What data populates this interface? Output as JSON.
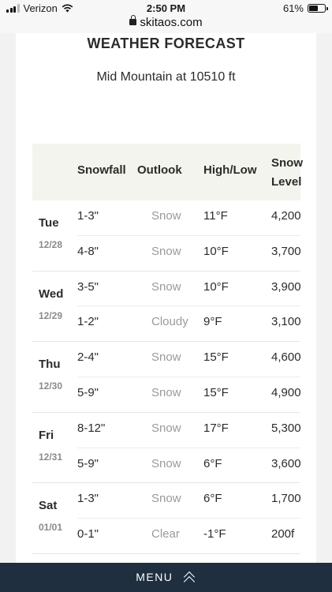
{
  "status_bar": {
    "carrier": "Verizon",
    "time": "2:50 PM",
    "battery_percent": "61%",
    "battery_level": 0.61,
    "icons": [
      "signal-bars-icon",
      "wifi-icon",
      "battery-icon"
    ]
  },
  "url_bar": {
    "domain": "skitaos.com",
    "icon": "lock-icon"
  },
  "forecast": {
    "title": "WEATHER FORECAST",
    "subtitle": "Mid Mountain at 10510 ft",
    "columns": {
      "snowfall": "Snowfall",
      "outlook": "Outlook",
      "high_low": "High/Low",
      "snow_level_line1": "Snow",
      "snow_level_line2": "Level"
    },
    "days": [
      {
        "name": "Tue",
        "date": "12/28",
        "rows": [
          {
            "snowfall": "1-3\"",
            "outlook": "Snow",
            "high_low": "11°F",
            "snow_level": "4,200"
          },
          {
            "snowfall": "4-8\"",
            "outlook": "Snow",
            "high_low": "10°F",
            "snow_level": "3,700"
          }
        ]
      },
      {
        "name": "Wed",
        "date": "12/29",
        "rows": [
          {
            "snowfall": "3-5\"",
            "outlook": "Snow",
            "high_low": "10°F",
            "snow_level": "3,900"
          },
          {
            "snowfall": "1-2\"",
            "outlook": "Cloudy",
            "high_low": "9°F",
            "snow_level": "3,100"
          }
        ]
      },
      {
        "name": "Thu",
        "date": "12/30",
        "rows": [
          {
            "snowfall": "2-4\"",
            "outlook": "Snow",
            "high_low": "15°F",
            "snow_level": "4,600"
          },
          {
            "snowfall": "5-9\"",
            "outlook": "Snow",
            "high_low": "15°F",
            "snow_level": "4,900"
          }
        ]
      },
      {
        "name": "Fri",
        "date": "12/31",
        "rows": [
          {
            "snowfall": "8-12\"",
            "outlook": "Snow",
            "high_low": "17°F",
            "snow_level": "5,300"
          },
          {
            "snowfall": "5-9\"",
            "outlook": "Snow",
            "high_low": "6°F",
            "snow_level": "3,600"
          }
        ]
      },
      {
        "name": "Sat",
        "date": "01/01",
        "rows": [
          {
            "snowfall": "1-3\"",
            "outlook": "Snow",
            "high_low": "6°F",
            "snow_level": "1,700"
          },
          {
            "snowfall": "0-1\"",
            "outlook": "Clear",
            "high_low": "-1°F",
            "snow_level": "200f"
          }
        ]
      }
    ]
  },
  "menu": {
    "label": "MENU",
    "icon": "chevron-double-up-icon"
  },
  "colors": {
    "menu_bg": "#1f2f40",
    "header_bg": "#f4f4ee",
    "outlook_text": "#9a9a9a"
  }
}
